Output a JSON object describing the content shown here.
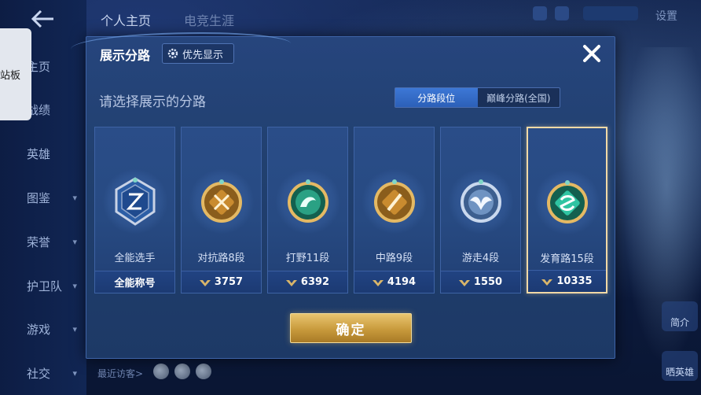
{
  "background": {
    "top_tabs": [
      "个人主页",
      "电竞生涯"
    ],
    "side_tab_label": "站板",
    "nav_items": [
      {
        "label": "主页",
        "chevron": false
      },
      {
        "label": "战绩",
        "chevron": false
      },
      {
        "label": "英雄",
        "chevron": false
      },
      {
        "label": "图鉴",
        "chevron": true
      },
      {
        "label": "荣誉",
        "chevron": true
      },
      {
        "label": "护卫队",
        "chevron": true
      },
      {
        "label": "游戏",
        "chevron": true
      },
      {
        "label": "社交",
        "chevron": true
      }
    ],
    "top_right_label": "设置",
    "recent_visitors_label": "最近访客>",
    "right_buttons": [
      "简介",
      "晒英雄"
    ]
  },
  "modal": {
    "title": "展示分路",
    "priority_button": "优先显示",
    "subtitle": "请选择展示的分路",
    "segments": [
      {
        "label": "分路段位",
        "active": true
      },
      {
        "label": "巅峰分路(全国)",
        "active": false
      }
    ],
    "cards": [
      {
        "name": "全能选手",
        "footer": "全能称号",
        "has_wing": false,
        "badge": "allround-badge-icon",
        "emblem": "#a9b8d6",
        "selected": false
      },
      {
        "name": "对抗路8段",
        "footer": "3757",
        "has_wing": true,
        "badge": "sword-badge-icon",
        "emblem": "#d9a74a",
        "selected": false
      },
      {
        "name": "打野11段",
        "footer": "6392",
        "has_wing": true,
        "badge": "dragon-badge-icon",
        "emblem": "#3fbf9a",
        "selected": false
      },
      {
        "name": "中路9段",
        "footer": "4194",
        "has_wing": true,
        "badge": "staff-badge-icon",
        "emblem": "#d9a74a",
        "selected": false
      },
      {
        "name": "游走4段",
        "footer": "1550",
        "has_wing": true,
        "badge": "wing-badge-icon",
        "emblem": "#b9cde6",
        "selected": false
      },
      {
        "name": "发育路15段",
        "footer": "10335",
        "has_wing": true,
        "badge": "archer-badge-icon",
        "emblem": "#3fd1b0",
        "selected": true
      }
    ],
    "confirm_label": "确定"
  },
  "colors": {
    "accent_gold": "#e9c56f",
    "segment_active": "#3d78d6",
    "panel": "#26457d"
  }
}
